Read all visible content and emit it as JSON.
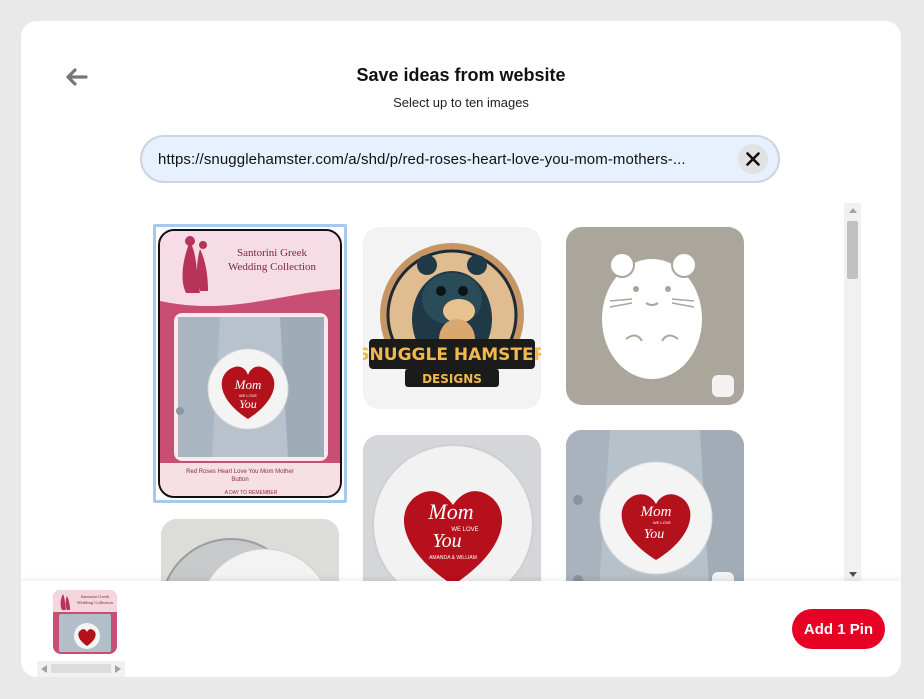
{
  "header": {
    "title": "Save ideas from website",
    "subtitle": "Select up to ten images"
  },
  "url_bar": {
    "value": "https://snugglehamster.com/a/shd/p/red-roses-heart-love-you-mom-mothers-..."
  },
  "images": [
    {
      "id": "wedding-button",
      "selected": true,
      "texts": {
        "brand_line1": "Santorini Greek",
        "brand_line2": "Wedding Collection",
        "heart_text_big": "Mom",
        "heart_text_small": "WE LOVE",
        "heart_text_big2": "You",
        "caption_line1": "Red Roses Heart Love You Mom Mother",
        "caption_line2": "Button",
        "footer_text": "A DAY TO REMEMBER"
      }
    },
    {
      "id": "snuggle-logo",
      "selected": false,
      "texts": {
        "logo_line1": "SNUGGLE HAMSTER",
        "logo_line2": "DESIGNS"
      }
    },
    {
      "id": "hamster-line-art",
      "selected": false
    },
    {
      "id": "mom-button-closeup",
      "selected": false,
      "texts": {
        "heart_text_big": "Mom",
        "heart_text_small": "WE LOVE",
        "heart_text_big2": "You",
        "heart_text_names": "AMANDA & WILLIAM"
      }
    },
    {
      "id": "mom-button-jacket",
      "selected": false,
      "texts": {
        "heart_text_big": "Mom",
        "heart_text_small": "WE LOVE",
        "heart_text_big2": "You"
      }
    },
    {
      "id": "button-back-view",
      "selected": false
    }
  ],
  "footer": {
    "add_button_label": "Add 1 Pin",
    "thumb_line1": "Santorini Greek",
    "thumb_line2": "Wedding Collection"
  },
  "colors": {
    "accent": "#e60023",
    "url_bar_bg": "#e7f0fd",
    "selection_outline": "#a6c9ee"
  },
  "icons": {
    "back": "arrow-left-icon",
    "clear": "x-icon",
    "check": "checkmark-icon"
  }
}
